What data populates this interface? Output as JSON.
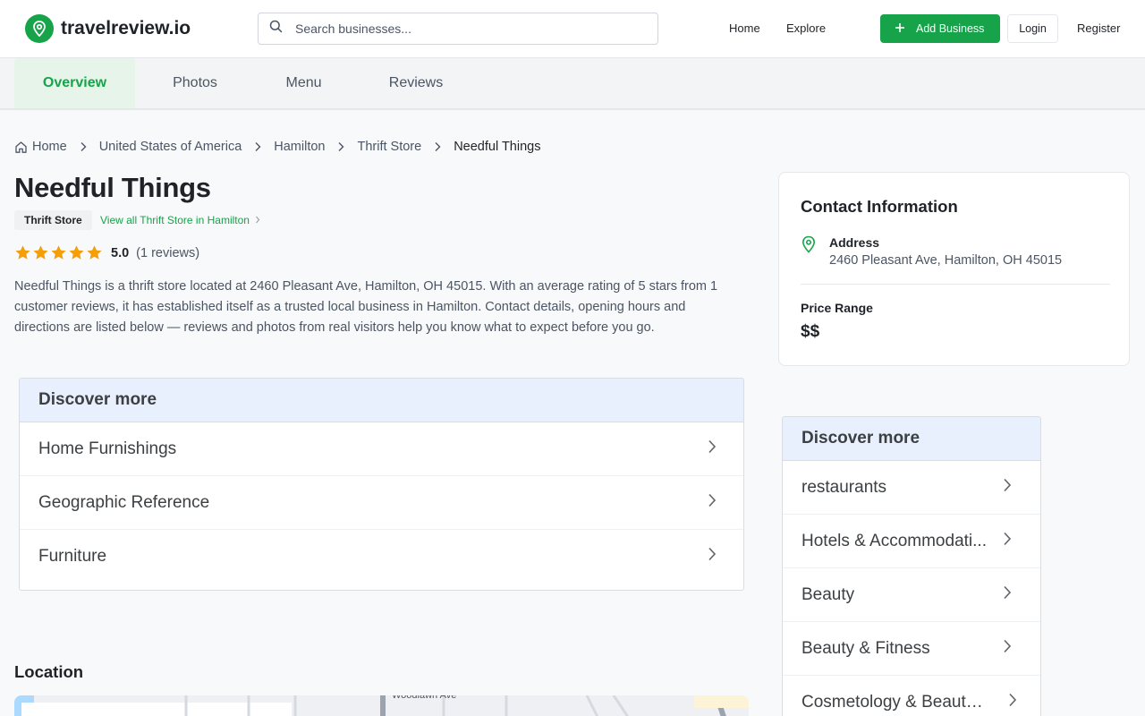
{
  "brand": {
    "name": "travelreview.io",
    "accent": "#16a34a"
  },
  "search": {
    "placeholder": "Search businesses...",
    "value": ""
  },
  "nav": {
    "home": "Home",
    "explore": "Explore",
    "add_business": "Add Business",
    "login": "Login",
    "register": "Register"
  },
  "tabs": [
    {
      "label": "Overview",
      "active": true
    },
    {
      "label": "Photos",
      "active": false
    },
    {
      "label": "Menu",
      "active": false
    },
    {
      "label": "Reviews",
      "active": false
    }
  ],
  "breadcrumb": [
    "Home",
    "United States of America",
    "Hamilton",
    "Thrift Store",
    "Needful Things"
  ],
  "business": {
    "name": "Needful Things",
    "category": "Thrift Store",
    "category_link": "View all Thrift Store in Hamilton",
    "rating": "5.0",
    "review_count": "(1 reviews)",
    "stars": 5,
    "description": "Needful Things is a thrift store located at 2460 Pleasant Ave, Hamilton, OH 45015. With an average rating of 5 stars from 1 customer reviews, it has established itself as a trusted local business in Hamilton. Contact details, opening hours and directions are listed below — reviews and photos from real visitors help you know what to expect before you go."
  },
  "discover_main": {
    "title": "Discover more",
    "items": [
      "Home Furnishings",
      "Geographic Reference",
      "Furniture"
    ]
  },
  "contact": {
    "title": "Contact Information",
    "address_label": "Address",
    "address": "2460 Pleasant Ave, Hamilton, OH 45015",
    "price_label": "Price Range",
    "price": "$$"
  },
  "discover_side": {
    "title": "Discover more",
    "items": [
      "restaurants",
      "Hotels & Accommodati...",
      "Beauty",
      "Beauty & Fitness",
      "Cosmetology & Beauty ..."
    ]
  },
  "location": {
    "title": "Location",
    "map_labels": [
      "Woodlawn Ave"
    ]
  }
}
